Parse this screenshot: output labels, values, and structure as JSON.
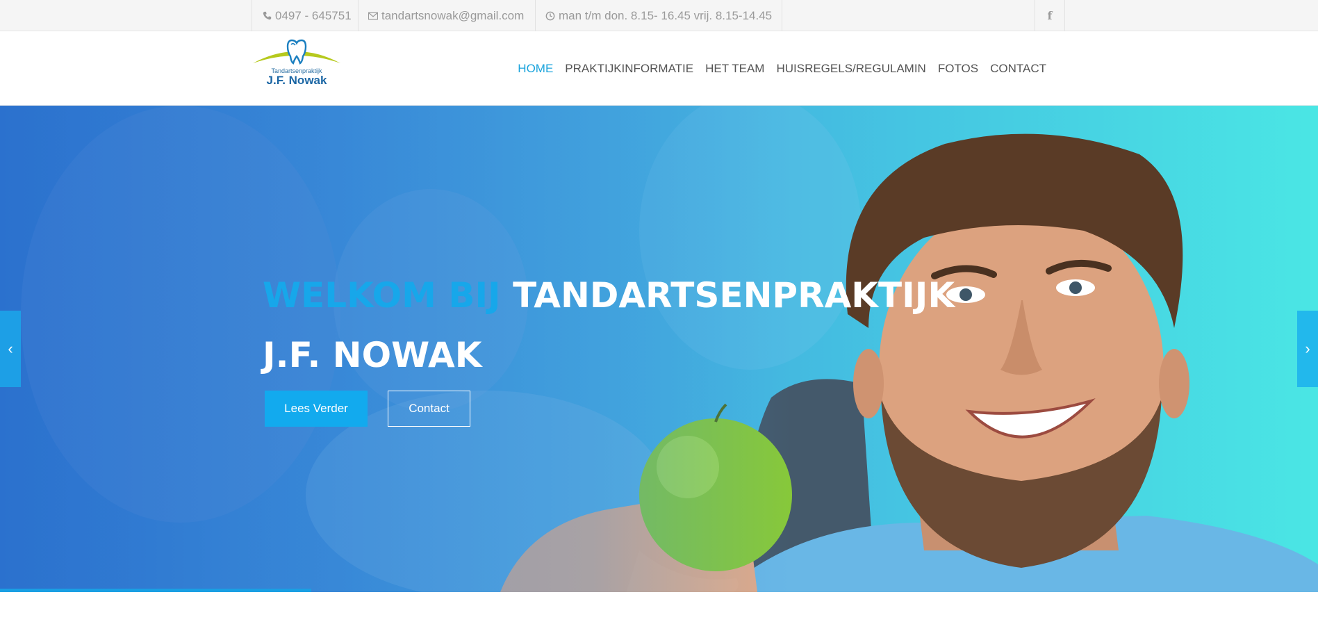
{
  "topbar": {
    "phone": "0497 - 645751",
    "email": "tandartsnowak@gmail.com",
    "hours": "man t/m don. 8.15- 16.45 vrij. 8.15-14.45",
    "social": "f"
  },
  "header": {
    "logo": {
      "tagline": "Tandartsenpraktijk",
      "name": "J.F. Nowak"
    },
    "nav": [
      {
        "label": "HOME",
        "active": true
      },
      {
        "label": "PRAKTIJKINFORMATIE"
      },
      {
        "label": "HET TEAM"
      },
      {
        "label": "HUISREGELS/REGULAMIN"
      },
      {
        "label": "FOTOS"
      },
      {
        "label": "CONTACT"
      }
    ]
  },
  "hero": {
    "title_highlight": "WELKOM BIJ",
    "title_rest": "TANDARTSENPRAKTIJK",
    "title_line2": "J.F. NOWAK",
    "primary_button": "Lees Verder",
    "secondary_button": "Contact",
    "prev_arrow": "‹",
    "next_arrow": "›"
  },
  "colors": {
    "accent": "#1aa3dc",
    "hero_left": "#2c73cc",
    "hero_right": "#4ae6e4",
    "button_blue": "#12aaee"
  }
}
